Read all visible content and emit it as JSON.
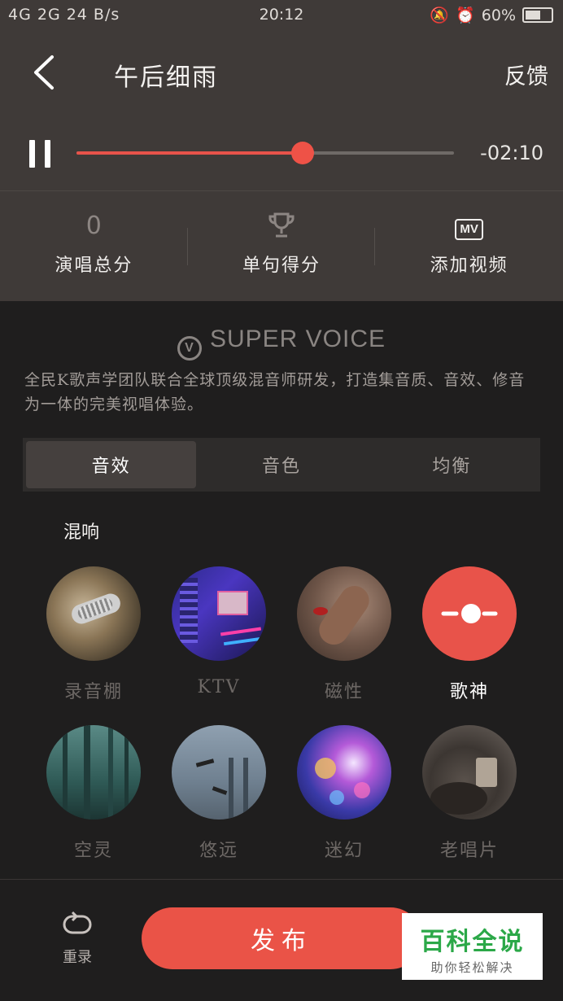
{
  "status_bar": {
    "left": "4G 2G 24 B/s",
    "time": "20:12",
    "battery": "60%"
  },
  "header": {
    "title": "午后细雨",
    "feedback": "反馈"
  },
  "player": {
    "remaining": "-02:10",
    "progress_fraction": 0.6
  },
  "stats": [
    {
      "value": "0",
      "label": "演唱总分"
    },
    {
      "icon": "trophy-icon",
      "label": "单句得分"
    },
    {
      "icon": "mv-camera-icon",
      "icon_text": "MV",
      "label": "添加视频"
    }
  ],
  "super_voice": {
    "logo": "SUPER VOICE",
    "logo_mark": "V",
    "description": "全民K歌声学团队联合全球顶级混音师研发，打造集音质、音效、修音为一体的完美视唱体验。"
  },
  "tabs": [
    {
      "label": "音效",
      "active": true
    },
    {
      "label": "音色",
      "active": false
    },
    {
      "label": "均衡",
      "active": false
    }
  ],
  "section_label": "混响",
  "effects": [
    {
      "name": "录音棚",
      "selected": false
    },
    {
      "name": "KTV",
      "selected": false
    },
    {
      "name": "磁性",
      "selected": false
    },
    {
      "name": "歌神",
      "selected": true
    },
    {
      "name": "空灵",
      "selected": false
    },
    {
      "name": "悠远",
      "selected": false
    },
    {
      "name": "迷幻",
      "selected": false
    },
    {
      "name": "老唱片",
      "selected": false
    }
  ],
  "bottom": {
    "rerecord": "重录",
    "publish": "发布"
  },
  "watermark": {
    "title": "百科全说",
    "subtitle": "助你轻松解决"
  },
  "colors": {
    "accent": "#ea5347",
    "top_bg": "#3f3a38",
    "body_bg": "#1f1e1e"
  }
}
